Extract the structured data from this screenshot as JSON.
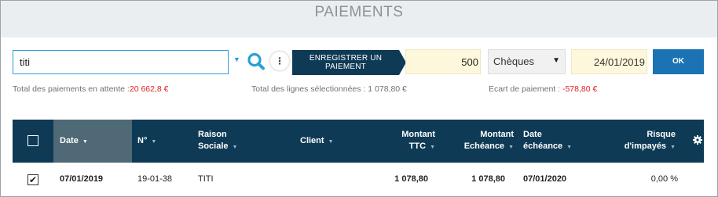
{
  "page": {
    "title": "PAIEMENTS"
  },
  "toolbar": {
    "search_value": "titi",
    "register_label": "ENREGISTRER UN PAIEMENT",
    "amount_value": "500",
    "payment_method": "Chèques",
    "payment_date": "24/01/2019",
    "ok_label": "OK",
    "more_label": "⋮"
  },
  "summary": {
    "pending_label": "Total des paiements en attente :",
    "pending_value": "20 662,8 €",
    "selected_label": "Total des lignes sélectionnées : 1 078,80 €",
    "gap_label": "Ecart de paiement : ",
    "gap_value": "-578,80 €"
  },
  "table": {
    "columns": {
      "date": "Date",
      "number": "N°",
      "raison_1": "Raison",
      "raison_2": "Sociale",
      "client": "Client",
      "ttc_1": "Montant",
      "ttc_2": "TTC",
      "ech_1": "Montant",
      "ech_2": "Echéance",
      "due_1": "Date",
      "due_2": "échéance",
      "risk_1": "Risque",
      "risk_2": "d'impayés"
    },
    "rows": [
      {
        "checked": "✔",
        "date": "07/01/2019",
        "number": "19-01-38",
        "raison_sociale": "TITI",
        "client": "",
        "montant_ttc": "1 078,80",
        "montant_echeance": "1 078,80",
        "date_echeance": "07/01/2020",
        "risque": "0,00 %"
      }
    ]
  },
  "colors": {
    "header_navy": "#0e3a55",
    "active_column": "#4f6976",
    "accent_blue": "#1b73b3",
    "negative_red": "#e02020"
  }
}
